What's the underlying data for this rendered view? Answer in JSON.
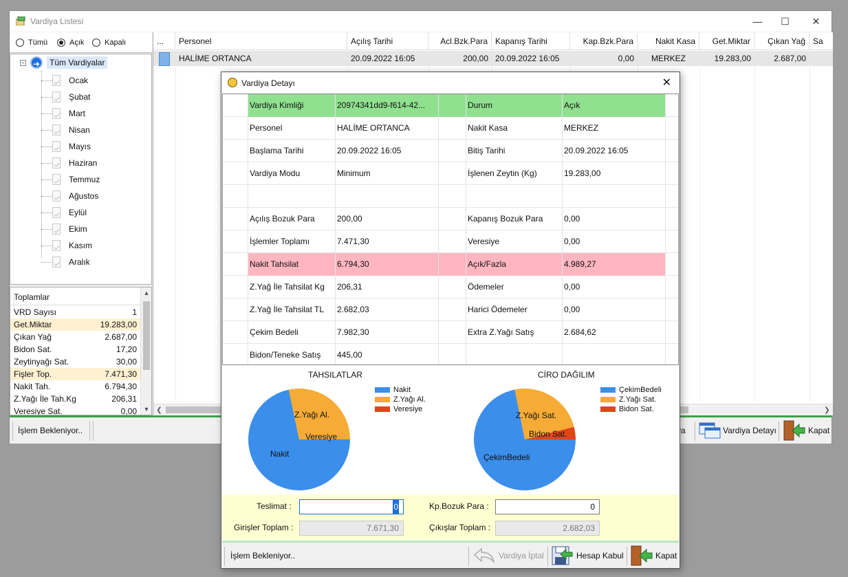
{
  "main_window": {
    "title": "Vardiya Listesi",
    "filters": [
      {
        "label": "Tümü",
        "checked": false
      },
      {
        "label": "Açık",
        "checked": true
      },
      {
        "label": "Kapalı",
        "checked": false
      }
    ],
    "tree": {
      "root": "Tüm Vardiyalar",
      "months": [
        "Ocak",
        "Şubat",
        "Mart",
        "Nisan",
        "Mayıs",
        "Haziran",
        "Temmuz",
        "Ağustos",
        "Eylül",
        "Ekim",
        "Kasım",
        "Aralık"
      ]
    },
    "totals": {
      "header": "Toplamlar",
      "rows": [
        {
          "label": "VRD Sayısı",
          "value": "1",
          "highlight": false
        },
        {
          "label": "Get.Miktar",
          "value": "19.283,00",
          "highlight": true
        },
        {
          "label": "Çıkan Yağ",
          "value": "2.687,00",
          "highlight": false
        },
        {
          "label": "Bidon Sat.",
          "value": "17,20",
          "highlight": false
        },
        {
          "label": "Zeytinyağı Sat.",
          "value": "30,00",
          "highlight": false
        },
        {
          "label": "Fişler Top.",
          "value": "7.471,30",
          "highlight": true
        },
        {
          "label": "Nakit Tah.",
          "value": "6.794,30",
          "highlight": false
        },
        {
          "label": "Z.Yağı İle Tah.Kg",
          "value": "206,31",
          "highlight": false
        },
        {
          "label": "Veresiye Sat.",
          "value": "0,00",
          "highlight": false
        }
      ]
    },
    "grid": {
      "columns": [
        "...",
        "Personel",
        "Açılış Tarihi",
        "Acl.Bzk.Para",
        "Kapanış Tarihi",
        "Kap.Bzk.Para",
        "Nakit Kasa",
        "Get.Miktar",
        "Çıkan Yağ",
        "Sa"
      ],
      "rows": [
        [
          "",
          "HALİME ORTANCA",
          "20.09.2022 16:05",
          "200,00",
          "20.09.2022 16:05",
          "0,00",
          "MERKEZ",
          "19.283,00",
          "2.687,00",
          ""
        ]
      ]
    },
    "status": "İşlem Bekleniyor..",
    "toolbar": {
      "partial_label": "ya",
      "detail_label": "Vardiya Detayı",
      "close_label": "Kapat"
    }
  },
  "dialog": {
    "title": "Vardiya Detayı",
    "rows": [
      {
        "k1": "Vardiya Kimliği",
        "v1": "20974341dd9-f614-42...",
        "k2": "Durum",
        "v2": "Açık",
        "style": "green"
      },
      {
        "k1": "Personel",
        "v1": "HALİME ORTANCA",
        "k2": "Nakit Kasa",
        "v2": "MERKEZ",
        "style": ""
      },
      {
        "k1": "Başlama Tarihi",
        "v1": "20.09.2022 16:05",
        "k2": "Bitiş Tarihi",
        "v2": "20.09.2022 16:05",
        "style": ""
      },
      {
        "k1": "Vardiya Modu",
        "v1": "Minimum",
        "k2": "İşlenen Zeytin (Kg)",
        "v2": "19.283,00",
        "style": ""
      },
      {
        "k1": "",
        "v1": "",
        "k2": "",
        "v2": "",
        "style": ""
      },
      {
        "k1": "Açılış Bozuk Para",
        "v1": "200,00",
        "k2": "Kapanış Bozuk Para",
        "v2": "0,00",
        "style": ""
      },
      {
        "k1": "İşlemler Toplamı",
        "v1": "7.471,30",
        "k2": "Veresiye",
        "v2": "0,00",
        "style": ""
      },
      {
        "k1": "Nakit Tahsilat",
        "v1": "6.794,30",
        "k2": "Açık/Fazla",
        "v2": "4.989,27",
        "style": "pink"
      },
      {
        "k1": "Z.Yağ İle Tahsilat Kg",
        "v1": "206,31",
        "k2": "Ödemeler",
        "v2": "0,00",
        "style": ""
      },
      {
        "k1": "Z.Yağ İle Tahsilat TL",
        "v1": "2.682,03",
        "k2": "Harici Ödemeler",
        "v2": "0,00",
        "style": ""
      },
      {
        "k1": "Çekim Bedeli",
        "v1": "7.982,30",
        "k2": "Extra Z.Yağı Satış",
        "v2": "2.684,62",
        "style": ""
      },
      {
        "k1": "Bidon/Teneke Satış",
        "v1": "445,00",
        "k2": "",
        "v2": "",
        "style": ""
      }
    ],
    "form": {
      "teslimat_label": "Teslimat :",
      "teslimat_value": "0",
      "kp_label": "Kp.Bozuk Para :",
      "kp_value": "0",
      "girisler_label": "Girişler Toplam :",
      "girisler_value": "7.671,30",
      "cikislar_label": "Çıkışlar Toplam :",
      "cikislar_value": "2.682,03"
    },
    "status": "İşlem Bekleniyor..",
    "buttons": {
      "cancel": "Vardiya İptal",
      "accept": "Hesap Kabul",
      "close": "Kapat"
    }
  },
  "chart_data": [
    {
      "type": "pie",
      "title": "TAHSILATLAR",
      "labels": [
        "Nakit",
        "Z.Yağı Al.",
        "Veresiye"
      ],
      "values": [
        6794.3,
        2682.03,
        0.0
      ],
      "colors": [
        "#3b8eea",
        "#f5ab35",
        "#e0461a"
      ],
      "legend": "right"
    },
    {
      "type": "pie",
      "title": "CİRO DAĞILIM",
      "labels": [
        "ÇekimBedeli",
        "Z.Yağı Sat.",
        "Bidon Sat."
      ],
      "values": [
        7982.3,
        2684.62,
        445.0
      ],
      "colors": [
        "#3b8eea",
        "#f5ab35",
        "#e0461a"
      ],
      "legend": "right"
    }
  ]
}
